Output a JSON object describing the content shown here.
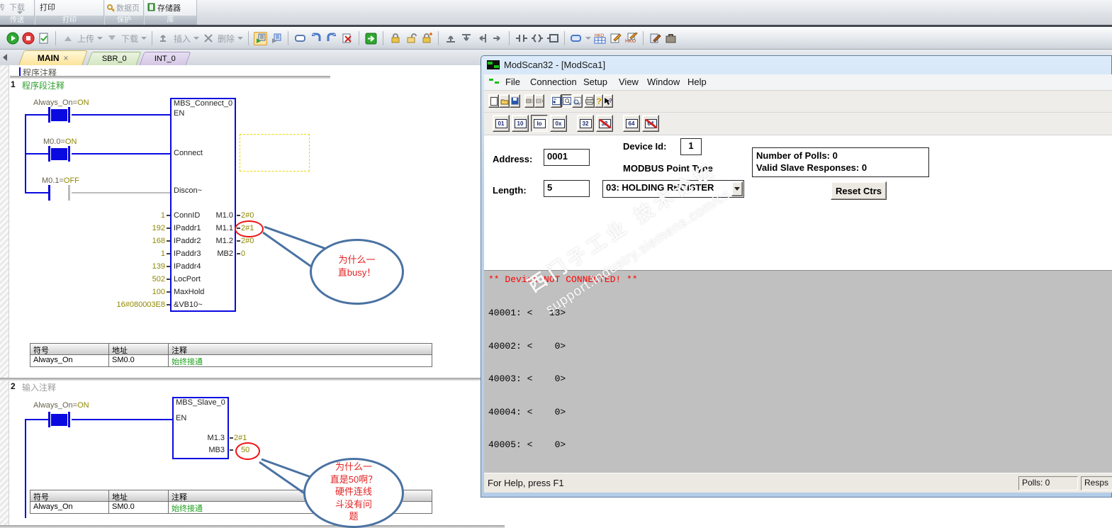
{
  "ribbon": {
    "partial": "传",
    "g1_btn": "下载",
    "g1_label": "传送",
    "g2_btn": "打印",
    "g2_label": "打印",
    "g3_btn": "数据页",
    "g3_label": "保护",
    "g4_btn": "存储器",
    "g4_label": "库"
  },
  "toolbar": {
    "upload": "上传",
    "download": "下载",
    "insert": "插入",
    "del": "删除"
  },
  "tabs": {
    "main": "MAIN",
    "close": "×",
    "sbr": "SBR_0",
    "int": "INT_0"
  },
  "program": {
    "title_comment": "程序注释",
    "sym": {
      "h1": "符号",
      "h2": "地址",
      "h3": "注释",
      "r1": "Always_On",
      "r2": "SM0.0",
      "r3": "始终接通"
    },
    "net1": {
      "number": "1",
      "comment": "程序段注释",
      "contact1_name": "Always_On=",
      "contact1_val": "ON",
      "contact2_name": "M0.0=",
      "contact2_val": "ON",
      "contact3_name": "M0.1=",
      "contact3_val": "OFF",
      "block": {
        "title": "MBS_Connect_0",
        "en": "EN",
        "in_connect": "Connect",
        "in_discon": "Discon~",
        "rows": [
          {
            "in": "1",
            "label": "ConnID"
          },
          {
            "in": "192",
            "label": "IPaddr1"
          },
          {
            "in": "168",
            "label": "IPaddr2"
          },
          {
            "in": "1",
            "label": "IPaddr3"
          },
          {
            "in": "139",
            "label": "IPaddr4"
          },
          {
            "in": "502",
            "label": "LocPort"
          },
          {
            "in": "100",
            "label": "MaxHold"
          },
          {
            "in": "16#080003E8",
            "label": "&VB10~"
          }
        ],
        "outs": [
          {
            "label": "M1.0",
            "val": "2#0"
          },
          {
            "label": "M1.1",
            "val": "2#1"
          },
          {
            "label": "M1.2",
            "val": "2#0"
          },
          {
            "label": "MB2",
            "val": "0"
          }
        ]
      },
      "callout": [
        "为什么一",
        "直busy！"
      ]
    },
    "net2": {
      "number": "2",
      "comment": "输入注释",
      "contact1_name": "Always_On=",
      "contact1_val": "ON",
      "block": {
        "title": "MBS_Slave_0",
        "en": "EN",
        "outs": [
          {
            "label": "M1.3",
            "val": "2#1"
          },
          {
            "label": "MB3",
            "val": "50"
          }
        ]
      },
      "callout": [
        "为什么一",
        "直是50啊？",
        "硬件连线",
        "斗没有问",
        "题"
      ]
    }
  },
  "modscan": {
    "title": "ModScan32 - [ModSca1]",
    "menus": [
      "File",
      "Connection",
      "Setup",
      "View",
      "Window",
      "Help"
    ],
    "formats": [
      "01",
      "10",
      "Io",
      "0x",
      "32",
      "32",
      "64",
      "64"
    ],
    "address_label": "Address:",
    "address_value": "0001",
    "length_label": "Length:",
    "length_value": "5",
    "device_id_label": "Device Id:",
    "device_id_value": "1",
    "point_type_label": "MODBUS Point Type",
    "point_type_value": "03: HOLDING REGISTER",
    "polls_text": "Number of Polls: 0",
    "responses_text": "Valid Slave Responses: 0",
    "reset_button": "Reset Ctrs",
    "status_line": "** Device NOT CONNECTED! **",
    "registers": [
      "40001: <   13>",
      "40002: <    0>",
      "40003: <    0>",
      "40004: <    0>",
      "40005: <    0>"
    ],
    "help_text": "For Help, press F1",
    "polls_panel": "Polls: 0",
    "resp_panel": "Resps",
    "watermark_line1": "西门子工业 技术论坛",
    "watermark_line2": "support.industry.siemens.com/cs",
    "accent_blue": "#b3cce8",
    "data_gray": "#c0c0c0",
    "alert_red": "#ff0000"
  }
}
